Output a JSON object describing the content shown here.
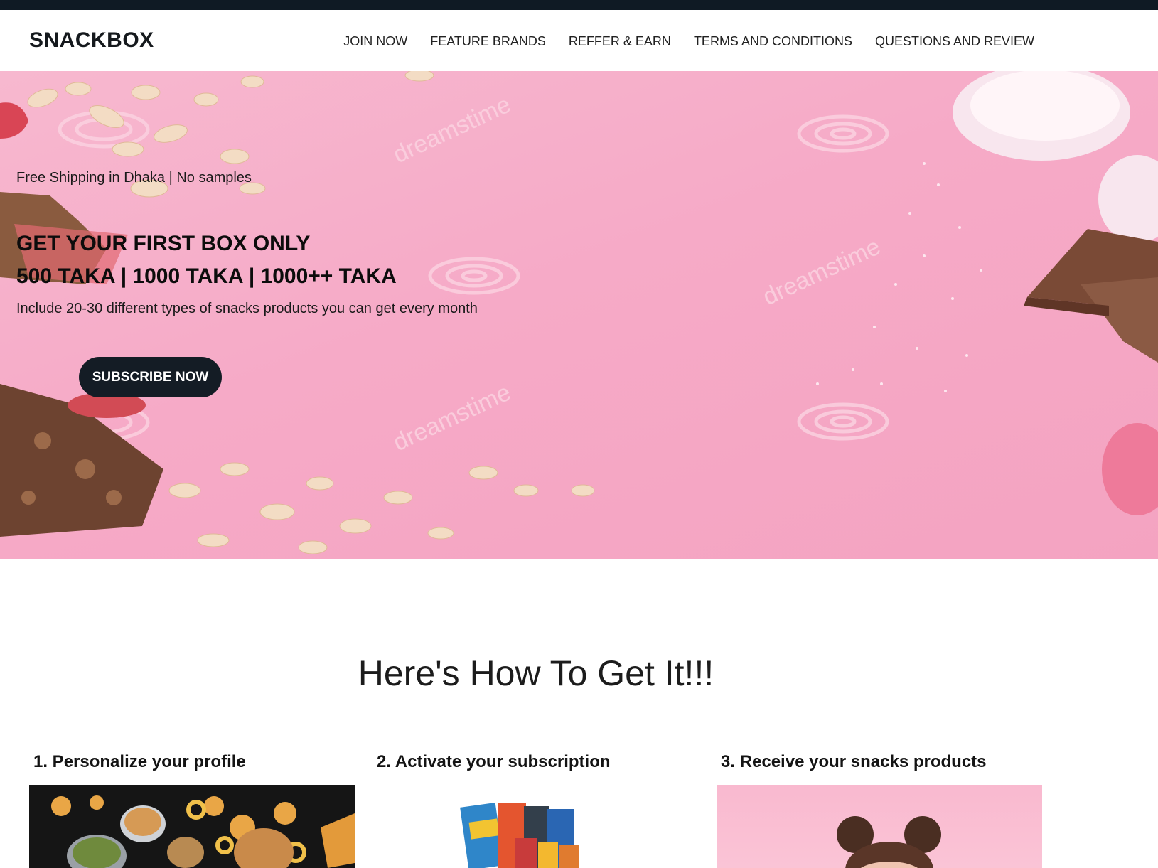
{
  "header": {
    "brand": "SNACKBOX",
    "nav": [
      "JOIN NOW",
      "FEATURE BRANDS",
      "REFFER & EARN",
      "TERMS AND CONDITIONS",
      "QUESTIONS AND REVIEW"
    ]
  },
  "hero": {
    "shipping_note": "Free Shipping in Dhaka | No samples",
    "headline_line1": "GET YOUR FIRST BOX ONLY",
    "headline_line2": "500 TAKA | 1000 TAKA | 1000++ TAKA",
    "subtitle": "Include 20-30 different types of snacks products you can get every month",
    "cta_label": "SUBSCRIBE NOW",
    "watermark": "dreamstime"
  },
  "how_it_works": {
    "title": "Here's How To Get It!!!",
    "steps": [
      {
        "title": "1. Personalize your profile"
      },
      {
        "title": "2. Activate your subscription"
      },
      {
        "title": "3. Receive your snacks products"
      }
    ]
  },
  "colors": {
    "top_bar": "#0f1a24",
    "hero_pink": "#f6aac7",
    "button_dark": "#141c25"
  }
}
